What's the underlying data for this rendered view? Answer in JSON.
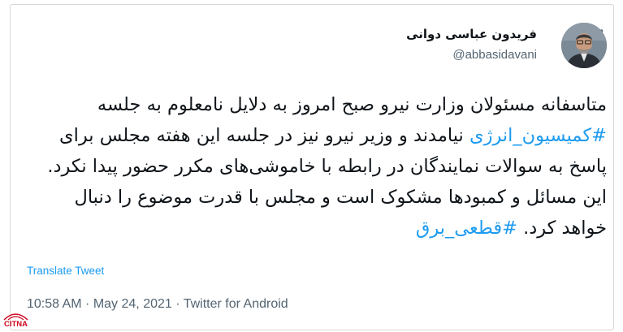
{
  "tweet": {
    "display_name": "فریدون عباسی دوانی",
    "handle": "@abbasidavani",
    "text_before": "متاسفانه مسئولان وزارت نیرو صبح امروز به دلایل نامعلوم به جلسه ",
    "hashtag_1": "#کمیسیون_انرژی",
    "text_middle": " نیامدند و وزیر نیرو نیز در جلسه این هفته مجلس برای پاسخ به سوالات نمایندگان در رابطه با خاموشی‌های مکرر حضور پیدا نکرد. این مسائل و کمبودها مشکوک است و مجلس با قدرت موضوع را دنبال خواهد کرد. ",
    "hashtag_2": "#قطعی_برق",
    "translate_label": "Translate Tweet",
    "time": "10:58 AM",
    "separator": " · ",
    "date": "May 24, 2021",
    "source": "Twitter for Android"
  },
  "watermark": {
    "text": "CITNA"
  },
  "colors": {
    "accent": "#1d9bf0",
    "text": "#0f1419",
    "muted": "#536471"
  },
  "icons": {
    "more": "more-horizontal-icon"
  }
}
